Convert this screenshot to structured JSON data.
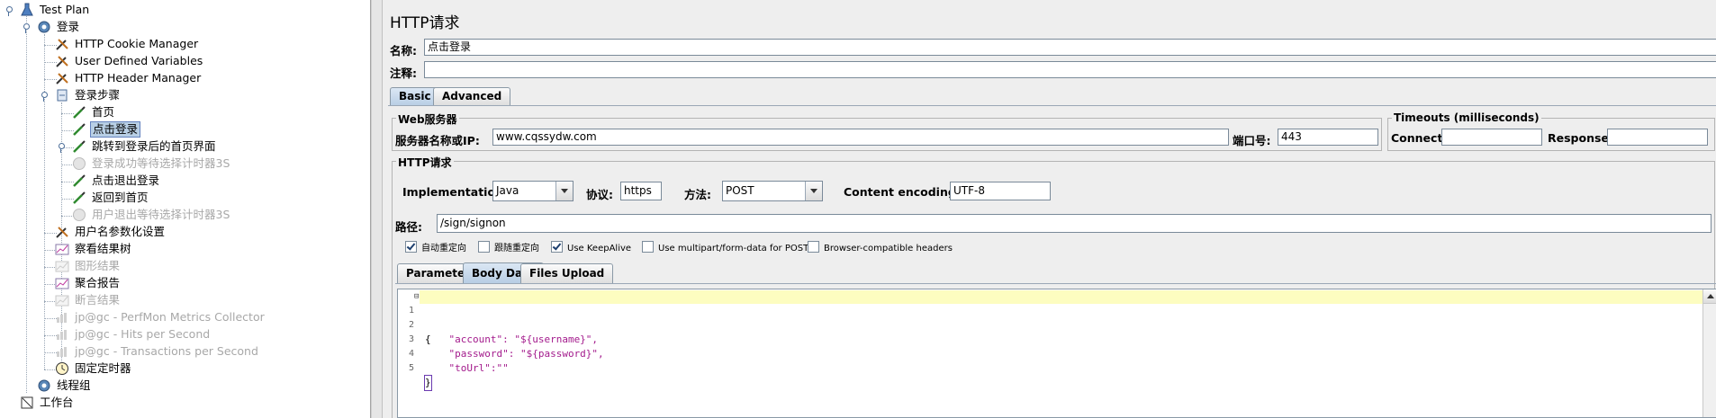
{
  "tree": {
    "items": [
      {
        "label": "Test Plan",
        "icon": "flask-icon",
        "disabled": false
      },
      {
        "label": "登录",
        "icon": "gear-icon",
        "disabled": false
      },
      {
        "label": "HTTP Cookie Manager",
        "icon": "wrench-icon",
        "disabled": false
      },
      {
        "label": "User Defined Variables",
        "icon": "wrench-icon",
        "disabled": false
      },
      {
        "label": "HTTP Header Manager",
        "icon": "wrench-icon",
        "disabled": false
      },
      {
        "label": "登录步骤",
        "icon": "controller-icon",
        "disabled": false
      },
      {
        "label": "首页",
        "icon": "pipette-icon",
        "disabled": false
      },
      {
        "label": "点击登录",
        "icon": "pipette-icon",
        "disabled": false
      },
      {
        "label": "跳转到登录后的首页界面",
        "icon": "pipette-icon",
        "disabled": false
      },
      {
        "label": "登录成功等待选择计时器3S",
        "icon": "timer-icon",
        "disabled": true
      },
      {
        "label": "点击退出登录",
        "icon": "pipette-icon",
        "disabled": false
      },
      {
        "label": "返回到首页",
        "icon": "pipette-icon",
        "disabled": false
      },
      {
        "label": "用户退出等待选择计时器3S",
        "icon": "timer-icon",
        "disabled": true
      },
      {
        "label": "用户名参数化设置",
        "icon": "wrench-icon",
        "disabled": false
      },
      {
        "label": "察看结果树",
        "icon": "chart-icon",
        "disabled": false
      },
      {
        "label": "图形结果",
        "icon": "chart-icon",
        "disabled": true
      },
      {
        "label": "聚合报告",
        "icon": "chart-icon",
        "disabled": false
      },
      {
        "label": "断言结果",
        "icon": "chart-icon",
        "disabled": true
      },
      {
        "label": "jp@gc - PerfMon Metrics Collector",
        "icon": "chart-icon",
        "disabled": true
      },
      {
        "label": "jp@gc - Hits per Second",
        "icon": "chart-icon",
        "disabled": true
      },
      {
        "label": "jp@gc - Transactions per Second",
        "icon": "chart-icon",
        "disabled": true
      },
      {
        "label": "固定定时器",
        "icon": "timer-icon",
        "disabled": false
      },
      {
        "label": "线程组",
        "icon": "gear-icon",
        "disabled": false
      },
      {
        "label": "工作台",
        "icon": "workbench-icon",
        "disabled": false
      }
    ]
  },
  "panel": {
    "title": "HTTP请求",
    "name_label": "名称:",
    "name_value": "点击登录",
    "comment_label": "注释:",
    "comment_value": "",
    "tabs": [
      "Basic",
      "Advanced"
    ],
    "web_server_title": "Web服务器",
    "server_label": "服务器名称或IP:",
    "server_value": "www.cqssydw.com",
    "port_label": "端口号:",
    "port_value": "443",
    "timeouts_title": "Timeouts (milliseconds)",
    "connect_label": "Connect:",
    "connect_value": "",
    "response_label": "Response:",
    "response_value": "",
    "http_title": "HTTP请求",
    "impl_label": "Implementation:",
    "impl_value": "Java",
    "protocol_label": "协议:",
    "protocol_value": "https",
    "method_label": "方法:",
    "method_value": "POST",
    "encoding_label": "Content encoding:",
    "encoding_value": "UTF-8",
    "path_label": "路径:",
    "path_value": "/sign/signon",
    "checkboxes": [
      {
        "label": "自动重定向",
        "checked": true
      },
      {
        "label": "跟随重定向",
        "checked": false
      },
      {
        "label": "Use KeepAlive",
        "checked": true
      },
      {
        "label": "Use multipart/form-data for POST",
        "checked": false
      },
      {
        "label": "Browser-compatible headers",
        "checked": false
      }
    ],
    "subtabs": [
      "Parameters",
      "Body Data",
      "Files Upload"
    ],
    "body_lines": [
      {
        "num": "1",
        "text": "{"
      },
      {
        "num": "2",
        "text": "    \"account\": \"${username}\","
      },
      {
        "num": "3",
        "text": "    \"password\": \"${password}\","
      },
      {
        "num": "4",
        "text": "    \"toUrl\":\"\""
      },
      {
        "num": "5",
        "text": "}"
      }
    ]
  }
}
